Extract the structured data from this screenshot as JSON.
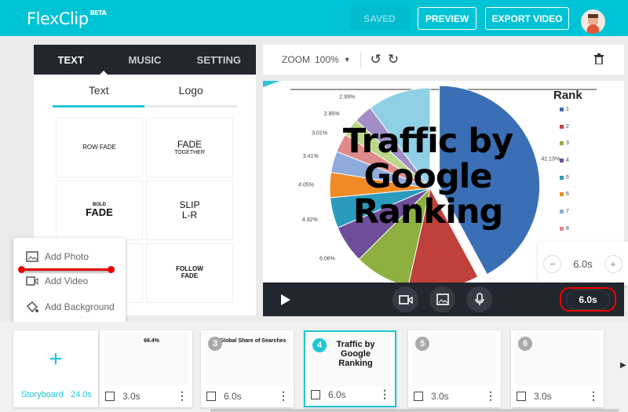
{
  "header": {
    "logo": "FlexClip",
    "beta": "BETA",
    "saved": "SAVED",
    "preview": "PREVIEW",
    "export": "EXPORT VIDEO",
    "accent": "#00c3d6"
  },
  "left_panel": {
    "tabs": [
      "TEXT",
      "MUSIC",
      "SETTING"
    ],
    "subtabs": [
      "Text",
      "Logo"
    ],
    "cards": [
      {
        "top": "",
        "main": "ROW FADE"
      },
      {
        "top": "FADE",
        "main": "TOGETHER"
      },
      {
        "top": "BOLD",
        "main": "FADE"
      },
      {
        "top": "SLIP",
        "main": "L-R"
      },
      {
        "top": "",
        "main": ""
      },
      {
        "top": "FOLLOW",
        "main": "FADE"
      }
    ]
  },
  "add_menu": {
    "items": [
      "Add Photo",
      "Add Video",
      "Add Background"
    ]
  },
  "toolbar": {
    "zoom_label": "ZOOM",
    "zoom_value": "100%"
  },
  "stage": {
    "title": [
      "Traffic by",
      "Google",
      "Ranking"
    ],
    "legend_title": "Rank",
    "legend": [
      "1",
      "2",
      "3",
      "4",
      "5",
      "6",
      "7",
      "8"
    ],
    "slices": [
      {
        "v": 42.13,
        "label": "42.13%",
        "color": "#3a6fb5"
      },
      {
        "v": 11.4,
        "label": "",
        "color": "#c0413b"
      },
      {
        "v": 9.0,
        "label": "",
        "color": "#8db040"
      },
      {
        "v": 6.06,
        "label": "6.06%",
        "color": "#6f4e99"
      },
      {
        "v": 4.92,
        "label": "4.92%",
        "color": "#2b9bbd"
      },
      {
        "v": 4.05,
        "label": "4.05%",
        "color": "#f08a24"
      },
      {
        "v": 3.41,
        "label": "3.41%",
        "color": "#8fabdc"
      },
      {
        "v": 3.01,
        "label": "3.01%",
        "color": "#e08b8b"
      },
      {
        "v": 2.85,
        "label": "2.85%",
        "color": "#bcd68a"
      },
      {
        "v": 2.99,
        "label": "2.99%",
        "color": "#a18ec7"
      },
      {
        "v": 10.18,
        "label": "10.18%",
        "color": "#8fd0e6"
      }
    ]
  },
  "duration": {
    "value": "6.0s",
    "minus": "−",
    "plus": "+"
  },
  "storyboard": {
    "label": "Storyboard",
    "total": "24.0s",
    "plus": "+",
    "clips": [
      {
        "num": "2",
        "dur": "3.0s",
        "caption": "66.4%"
      },
      {
        "num": "3",
        "dur": "6.0s",
        "caption": "Global Share of Searches"
      },
      {
        "num": "4",
        "dur": "6.0s",
        "caption": "Traffic by Google Ranking"
      },
      {
        "num": "5",
        "dur": "3.0s",
        "caption": ""
      },
      {
        "num": "6",
        "dur": "3.0s",
        "caption": ""
      }
    ]
  }
}
